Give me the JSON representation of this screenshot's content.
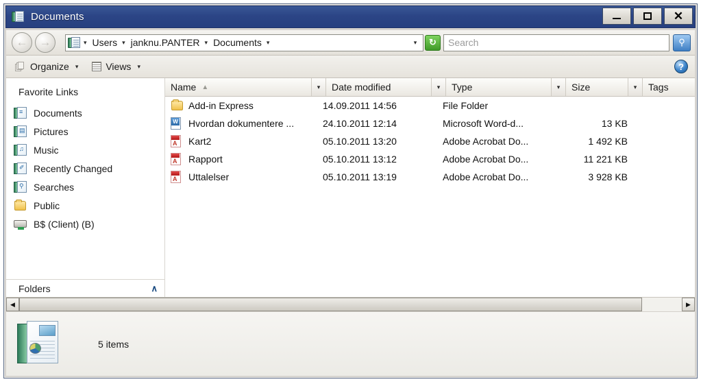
{
  "window": {
    "title": "Documents",
    "title_icon": "documents-folder-icon",
    "minimize_label": "",
    "maximize_label": "",
    "close_label": "✕"
  },
  "navigation": {
    "back_icon": "arrow-left-icon",
    "back_glyph": "←",
    "forward_icon": "arrow-right-icon",
    "forward_glyph": "→",
    "address_icon": "documents-folder-icon",
    "breadcrumbs": [
      {
        "label": "Users"
      },
      {
        "label": "janknu.PANTER"
      },
      {
        "label": "Documents"
      }
    ],
    "breadcrumb_arrow": "▾",
    "address_dropdown_glyph": "▾",
    "refresh_icon": "refresh-icon",
    "refresh_glyph": "↻",
    "search_placeholder": "Search",
    "search_value": "",
    "search_go_icon": "search-icon",
    "search_go_glyph": "⚲"
  },
  "toolbar": {
    "organize_label": "Organize",
    "organize_caret": "▾",
    "views_label": "Views",
    "views_caret": "▾",
    "help_label": "?"
  },
  "sidebar": {
    "heading": "Favorite Links",
    "items": [
      {
        "label": "Documents",
        "icon": "documents-folder-icon",
        "overlay": "≡"
      },
      {
        "label": "Pictures",
        "icon": "pictures-folder-icon",
        "overlay": "▤"
      },
      {
        "label": "Music",
        "icon": "music-folder-icon",
        "overlay": "♫"
      },
      {
        "label": "Recently Changed",
        "icon": "recently-changed-folder-icon",
        "overlay": "✐"
      },
      {
        "label": "Searches",
        "icon": "searches-folder-icon",
        "overlay": "⚲"
      },
      {
        "label": "Public",
        "icon": "public-folder-icon",
        "overlay": ""
      },
      {
        "label": "B$ (Client) (B)",
        "icon": "network-drive-icon",
        "overlay": ""
      }
    ],
    "folders_label": "Folders",
    "folders_chevron": "∧"
  },
  "file_list": {
    "columns": [
      {
        "label": "Name",
        "sorted": "ascending",
        "sort_glyph": "▲"
      },
      {
        "label": "Date modified",
        "sorted": "",
        "sort_glyph": ""
      },
      {
        "label": "Type",
        "sorted": "",
        "sort_glyph": ""
      },
      {
        "label": "Size",
        "sorted": "",
        "sort_glyph": ""
      },
      {
        "label": "Tags",
        "sorted": "",
        "sort_glyph": ""
      }
    ],
    "column_dropdown_glyph": "▾",
    "rows": [
      {
        "name": "Add-in Express",
        "icon": "yellow-folder-icon",
        "date_modified": "14.09.2011 14:56",
        "type": "File Folder",
        "size": "",
        "tags": ""
      },
      {
        "name": "Hvordan dokumentere ...",
        "icon": "word-document-icon",
        "date_modified": "24.10.2011 12:14",
        "type": "Microsoft Word-d...",
        "size": "13 KB",
        "tags": ""
      },
      {
        "name": "Kart2",
        "icon": "pdf-document-icon",
        "date_modified": "05.10.2011 13:20",
        "type": "Adobe Acrobat Do...",
        "size": "1 492 KB",
        "tags": ""
      },
      {
        "name": "Rapport",
        "icon": "pdf-document-icon",
        "date_modified": "05.10.2011 13:12",
        "type": "Adobe Acrobat Do...",
        "size": "11 221 KB",
        "tags": ""
      },
      {
        "name": "Uttalelser",
        "icon": "pdf-document-icon",
        "date_modified": "05.10.2011 13:19",
        "type": "Adobe Acrobat Do...",
        "size": "3 928 KB",
        "tags": ""
      }
    ]
  },
  "scrollbar": {
    "left_glyph": "◀",
    "right_glyph": "▶"
  },
  "status": {
    "icon": "documents-folder-large-icon",
    "text": "5 items"
  },
  "colors": {
    "titlebar": "#2c4586",
    "chrome": "#e8e5de",
    "list_background": "#ffffff",
    "refresh_green": "#3f9a28",
    "search_blue": "#3f7fc4",
    "help_blue": "#3a82c9",
    "chevron_blue": "#17487f"
  }
}
